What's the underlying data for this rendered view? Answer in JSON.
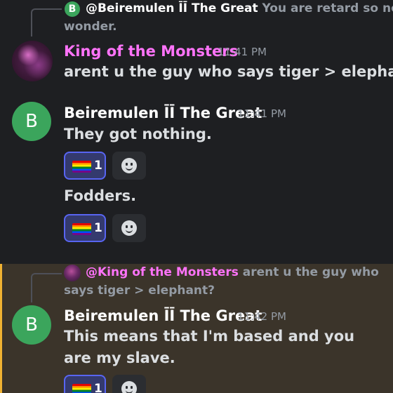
{
  "messages": [
    {
      "reply": {
        "author": "@Beiremulen ĪĪ The Great",
        "avatar_letter": "B",
        "text_line1": "You are retard so no",
        "text_line2": "wonder."
      }
    },
    {
      "author": "King of the Monsters",
      "time": "11:41 PM",
      "lines": [
        "arent u the guy who says tiger > elephant?"
      ]
    },
    {
      "author": "Beiremulen ĪĪ The Great",
      "avatar_letter": "B",
      "time": "11:41 PM",
      "lines": [
        "They got nothing.",
        "Fodders."
      ],
      "reactions": [
        {
          "emoji": "rainbow-flag",
          "count": "1"
        },
        {
          "emoji": "rainbow-flag",
          "count": "1"
        }
      ]
    },
    {
      "reply": {
        "author": "@King of the Monsters",
        "text_line1": "arent u the guy who",
        "text_line2": "says tiger > elephant?"
      },
      "author": "Beiremulen ĪĪ The Great",
      "avatar_letter": "B",
      "time": "11:42 PM",
      "text": "This means that I'm based and you are my slave.",
      "reactions": [
        {
          "emoji": "rainbow-flag",
          "count": "1"
        }
      ]
    }
  ],
  "colors": {
    "background": "#1e1f22",
    "mention_highlight": "#3b342a",
    "mention_bar": "#f0b232",
    "pink_role": "#ff73fa",
    "avatar_green": "#3ba55c",
    "reaction_active": "#5865f2"
  }
}
